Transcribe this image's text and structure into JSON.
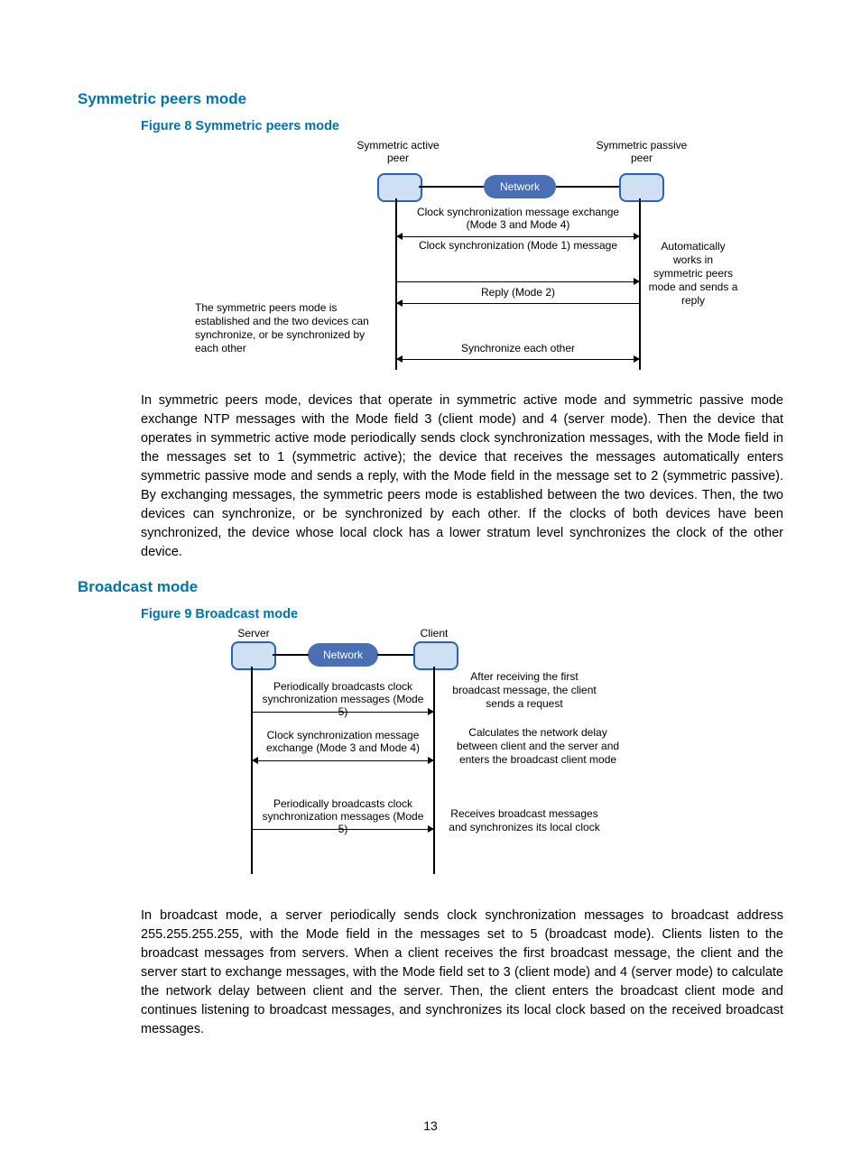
{
  "page_number": "13",
  "section1": {
    "heading": "Symmetric peers mode",
    "figure_caption": "Figure 8 Symmetric peers mode",
    "body": "In symmetric peers mode, devices that operate in symmetric active mode and symmetric passive mode exchange NTP messages with the Mode field 3 (client mode) and 4 (server mode). Then the device that operates in symmetric active mode periodically sends clock synchronization messages, with the Mode field in the messages set to 1 (symmetric active); the device that receives the messages automatically enters symmetric passive mode and sends a reply, with the Mode field in the message set to 2 (symmetric passive). By exchanging messages, the symmetric peers mode is established between the two devices. Then, the two devices can synchronize, or be synchronized by each other. If the clocks of both devices have been synchronized, the device whose local clock has a lower stratum level synchronizes the clock of the other device."
  },
  "fig8": {
    "active_peer": "Symmetric active peer",
    "passive_peer": "Symmetric passive peer",
    "network": "Network",
    "msg1": "Clock synchronization message exchange (Mode 3 and Mode 4)",
    "msg2": "Clock synchronization (Mode 1) message",
    "msg3": "Reply  (Mode 2)",
    "msg4": "Synchronize each other",
    "note_right": "Automatically works in symmetric peers mode and sends a reply",
    "note_left": "The symmetric peers mode is established and the two devices can  synchronize, or be synchronized by each other"
  },
  "section2": {
    "heading": "Broadcast mode",
    "figure_caption": "Figure 9 Broadcast mode",
    "body": "In broadcast mode, a server periodically sends clock synchronization messages to broadcast address 255.255.255.255, with the Mode field in the messages set to 5 (broadcast mode). Clients listen to the broadcast messages from servers. When a client receives the first broadcast message, the client and the server start to exchange messages, with the Mode field set to 3 (client mode) and 4 (server mode) to calculate the network delay between client and the server. Then, the client enters the broadcast client mode and continues listening to broadcast messages, and synchronizes its local clock based on the received broadcast messages."
  },
  "fig9": {
    "server": "Server",
    "client": "Client",
    "network": "Network",
    "msg1": "Periodically broadcasts clock synchronization messages (Mode 5)",
    "msg2": "Clock synchronization message exchange (Mode 3 and Mode 4)",
    "msg3": "Periodically broadcasts clock synchronization messages (Mode 5)",
    "note1": "After receiving the first broadcast message, the client sends a request",
    "note2": "Calculates the network delay between client and the server and enters the broadcast client mode",
    "note3": "Receives broadcast messages and synchronizes its local clock"
  }
}
